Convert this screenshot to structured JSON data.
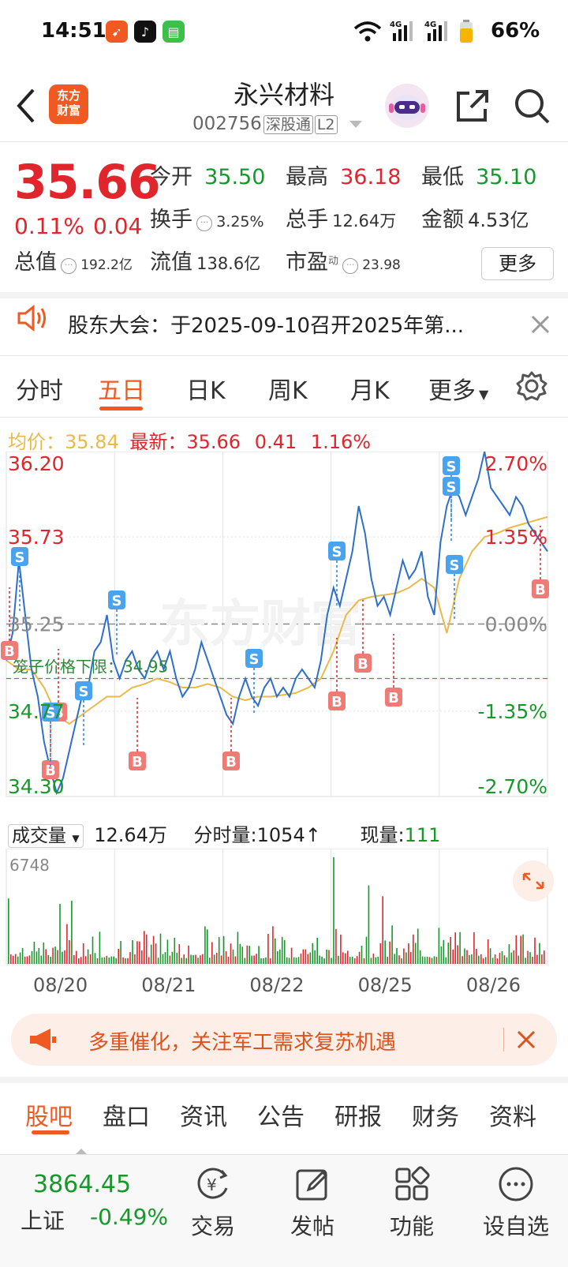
{
  "status_bar": {
    "time": "14:51",
    "battery": "66%",
    "net1": "4G",
    "net2": "4G"
  },
  "header": {
    "logo_text_1": "东方",
    "logo_text_2": "财富",
    "stock_name": "永兴材料",
    "stock_code": "002756",
    "tag_connect": "深股通",
    "tag_level": "L2"
  },
  "quote": {
    "price": "35.66",
    "change_pct": "0.11%",
    "change_amt": "0.04",
    "open_label": "今开",
    "open": "35.50",
    "high_label": "最高",
    "high": "36.18",
    "low_label": "最低",
    "low": "35.10",
    "turnover_label": "换手",
    "turnover": "3.25%",
    "volume_label": "总手",
    "volume": "12.64万",
    "amount_label": "金额",
    "amount": "4.53亿",
    "mktcap_label": "总值",
    "mktcap": "192.2亿",
    "float_label": "流值",
    "float": "138.6亿",
    "pe_label": "市盈",
    "pe_sup": "动",
    "pe": "23.98",
    "more_label": "更多"
  },
  "notice": {
    "text": "股东大会：于2025-09-10召开2025年第..."
  },
  "chart_tabs": [
    "分时",
    "五日",
    "日K",
    "周K",
    "月K",
    "更多"
  ],
  "avg_info": {
    "avg_label": "均价：",
    "avg_value": "35.84",
    "latest_label": "最新：",
    "latest_value": "35.66",
    "latest_change": "0.41",
    "latest_change_pct": "1.16%"
  },
  "chart_data": {
    "type": "line",
    "x_days": [
      "08/20",
      "08/21",
      "08/22",
      "08/25",
      "08/26"
    ],
    "price_axis": [
      "36.20",
      "35.73",
      "35.25",
      "34.77",
      "34.30"
    ],
    "pct_axis": [
      "2.70%",
      "1.35%",
      "0.00%",
      "-1.35%",
      "-2.70%"
    ],
    "ylim": [
      34.3,
      36.2
    ],
    "base_price": 35.25,
    "limit_label": "笼子价格下限：34.95",
    "limit_price": 34.95,
    "price_series": [
      35.05,
      35.2,
      35.6,
      35.3,
      35.0,
      34.85,
      34.6,
      34.45,
      34.32,
      34.4,
      34.55,
      34.7,
      34.85,
      34.9,
      35.1,
      35.15,
      35.3,
      35.05,
      34.95,
      35.05,
      35.1,
      35.0,
      34.95,
      35.05,
      35.1,
      35.0,
      35.1,
      34.95,
      34.85,
      34.9,
      35.0,
      35.15,
      35.05,
      34.95,
      34.85,
      34.75,
      34.7,
      34.85,
      34.95,
      34.85,
      34.8,
      34.9,
      34.95,
      34.85,
      34.9,
      34.85,
      34.95,
      35.0,
      34.95,
      34.9,
      35.05,
      35.3,
      35.45,
      35.35,
      35.5,
      35.65,
      35.9,
      35.75,
      35.5,
      35.35,
      35.4,
      35.3,
      35.45,
      35.6,
      35.5,
      35.55,
      35.65,
      35.4,
      35.3,
      35.7,
      35.9,
      36.0,
      35.95,
      35.85,
      35.95,
      36.05,
      36.2,
      36.0,
      35.95,
      35.9,
      35.85,
      35.95,
      35.9,
      35.8,
      35.75,
      35.7,
      35.65
    ],
    "avg_series": [
      35.05,
      35.0,
      35.0,
      34.9,
      34.75,
      34.7,
      34.75,
      34.8,
      34.85,
      34.85,
      34.9,
      34.92,
      34.95,
      34.93,
      34.9,
      34.9,
      34.92,
      34.9,
      34.85,
      34.83,
      34.85,
      34.85,
      34.86,
      34.87,
      34.9,
      34.95,
      35.1,
      35.3,
      35.38,
      35.4,
      35.41,
      35.42,
      35.45,
      35.5,
      35.45,
      35.2,
      35.5,
      35.65,
      35.73,
      35.75,
      35.78,
      35.8,
      35.82,
      35.84
    ],
    "buy_markers": [
      "B",
      "B",
      "B",
      "B",
      "B",
      "B",
      "B",
      "B",
      "B"
    ],
    "sell_markers": [
      "S",
      "S",
      "S",
      "S",
      "S",
      "S",
      "S",
      "S",
      "S"
    ],
    "watermark": "东方财富"
  },
  "volume": {
    "selector": "成交量",
    "total": "12.64万",
    "tick_label": "分时量:",
    "tick_value": "1054↑",
    "now_label": "现量:",
    "now_value": "111",
    "max": "6748"
  },
  "banner": {
    "text": "多重催化，关注军工需求复苏机遇"
  },
  "bottom_tabs": [
    "股吧",
    "盘口",
    "资讯",
    "公告",
    "研报",
    "财务",
    "资料"
  ],
  "footer": {
    "index_value": "3864.45",
    "index_name": "上证",
    "index_change": "-0.49%",
    "items": [
      "交易",
      "发帖",
      "功能",
      "设自选"
    ]
  },
  "colors": {
    "up": "#e0262c",
    "down": "#15992a",
    "accent": "#f05a22",
    "line": "#2f6fcc",
    "avg": "#e9b949"
  }
}
